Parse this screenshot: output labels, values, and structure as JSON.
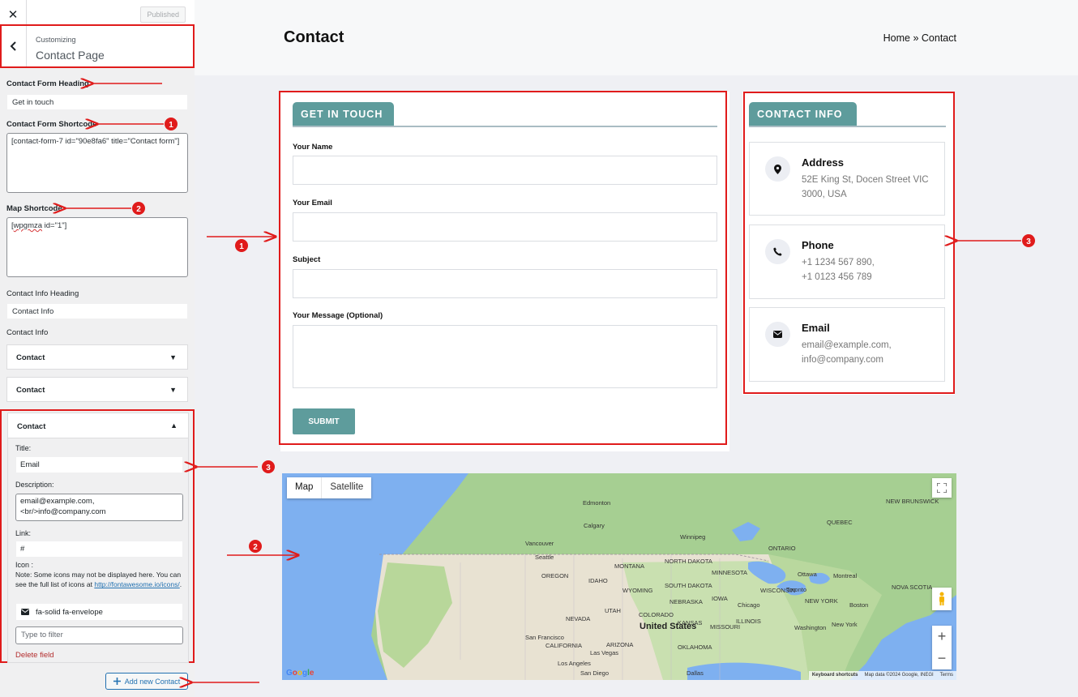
{
  "customizer": {
    "close_label": "✕",
    "published_label": "Published",
    "breadcrumb_small": "Customizing",
    "breadcrumb_title": "Contact Page",
    "contact_form_heading_label": "Contact Form Heading",
    "contact_form_heading_value": "Get in touch",
    "contact_form_shortcode_label": "Contact Form Shortcode",
    "contact_form_shortcode_value": "[contact-form-7 id=\"90e8fa6\" title=\"Contact form\"]",
    "map_shortcode_label": "Map Shortcode",
    "map_shortcode_value_a": "wpgmza",
    "map_shortcode_value_b": " id=\"1\"]",
    "contact_info_heading_label": "Contact Info Heading",
    "contact_info_heading_value": "Contact Info",
    "contact_info_label": "Contact Info",
    "repeater_items": [
      "Contact",
      "Contact"
    ],
    "open_item": {
      "header": "Contact",
      "title_label": "Title:",
      "title_value": "Email",
      "description_label": "Description:",
      "description_value_line1": "email@example.com,",
      "description_value_line2": "<br/>info@company.com",
      "link_label": "Link:",
      "link_value": "#",
      "icon_label": "Icon :",
      "icon_note": "Note: Some icons may not be displayed here. You can see the full list of icons at",
      "icon_note_link": "http://fontawesome.io/icons/",
      "icon_value": "fa-solid fa-envelope",
      "filter_placeholder": "Type to filter",
      "delete_label": "Delete field"
    },
    "add_button_label": "Add new Contact"
  },
  "preview": {
    "page_title": "Contact",
    "breadcrumb_home": "Home",
    "breadcrumb_sep": " » ",
    "breadcrumb_current": "Contact",
    "form_heading": "GET IN TOUCH",
    "fields": [
      {
        "label": "Your Name"
      },
      {
        "label": "Your Email"
      },
      {
        "label": "Subject"
      },
      {
        "label": "Your Message (Optional)"
      }
    ],
    "submit_label": "SUBMIT",
    "info_heading": "CONTACT INFO",
    "info_items": [
      {
        "title": "Address",
        "line1": "52E King St, Docen Street VIC",
        "line2": "3000, USA",
        "icon": "map-pin-icon"
      },
      {
        "title": "Phone",
        "line1": "+1 1234 567 890,",
        "line2": "+1 0123 456 789",
        "icon": "phone-icon"
      },
      {
        "title": "Email",
        "line1": "email@example.com,",
        "line2": "info@company.com",
        "icon": "envelope-icon"
      }
    ]
  },
  "map": {
    "tab_map": "Map",
    "tab_satellite": "Satellite",
    "zoom_in": "+",
    "zoom_out": "−",
    "google": "Google",
    "attrib_shortcuts": "Keyboard shortcuts",
    "attrib_data": "Map data ©2024 Google, INEGI",
    "attrib_terms": "Terms",
    "labels": [
      "Edmonton",
      "Calgary",
      "Vancouver",
      "Seattle",
      "Winnipeg",
      "NORTH DAKOTA",
      "SOUTH DAKOTA",
      "MINNESOTA",
      "WISCONSIN",
      "Ottawa",
      "Montreal",
      "Toronto",
      "NEW YORK",
      "Boston",
      "Chicago",
      "Washington",
      "New York",
      "United States",
      "San Francisco",
      "Los Angeles",
      "Las Vegas",
      "San Diego",
      "Dallas",
      "CALIFORNIA",
      "NEVADA",
      "OREGON",
      "IDAHO",
      "UTAH",
      "ARIZONA",
      "MONTANA",
      "WYOMING",
      "COLORADO",
      "NEBRASKA",
      "KANSAS",
      "OKLAHOMA",
      "IOWA",
      "ILLINOIS",
      "MISSOURI",
      "ONTARIO",
      "QUEBEC",
      "NEW BRUNSWICK",
      "NOVA SCOTIA"
    ]
  },
  "annotations": {
    "marker_1": "1",
    "marker_2": "2",
    "marker_3": "3"
  },
  "colors": {
    "accent": "#5e9c9c",
    "annotation_red": "#e01b1b",
    "wp_blue": "#2271b1"
  }
}
